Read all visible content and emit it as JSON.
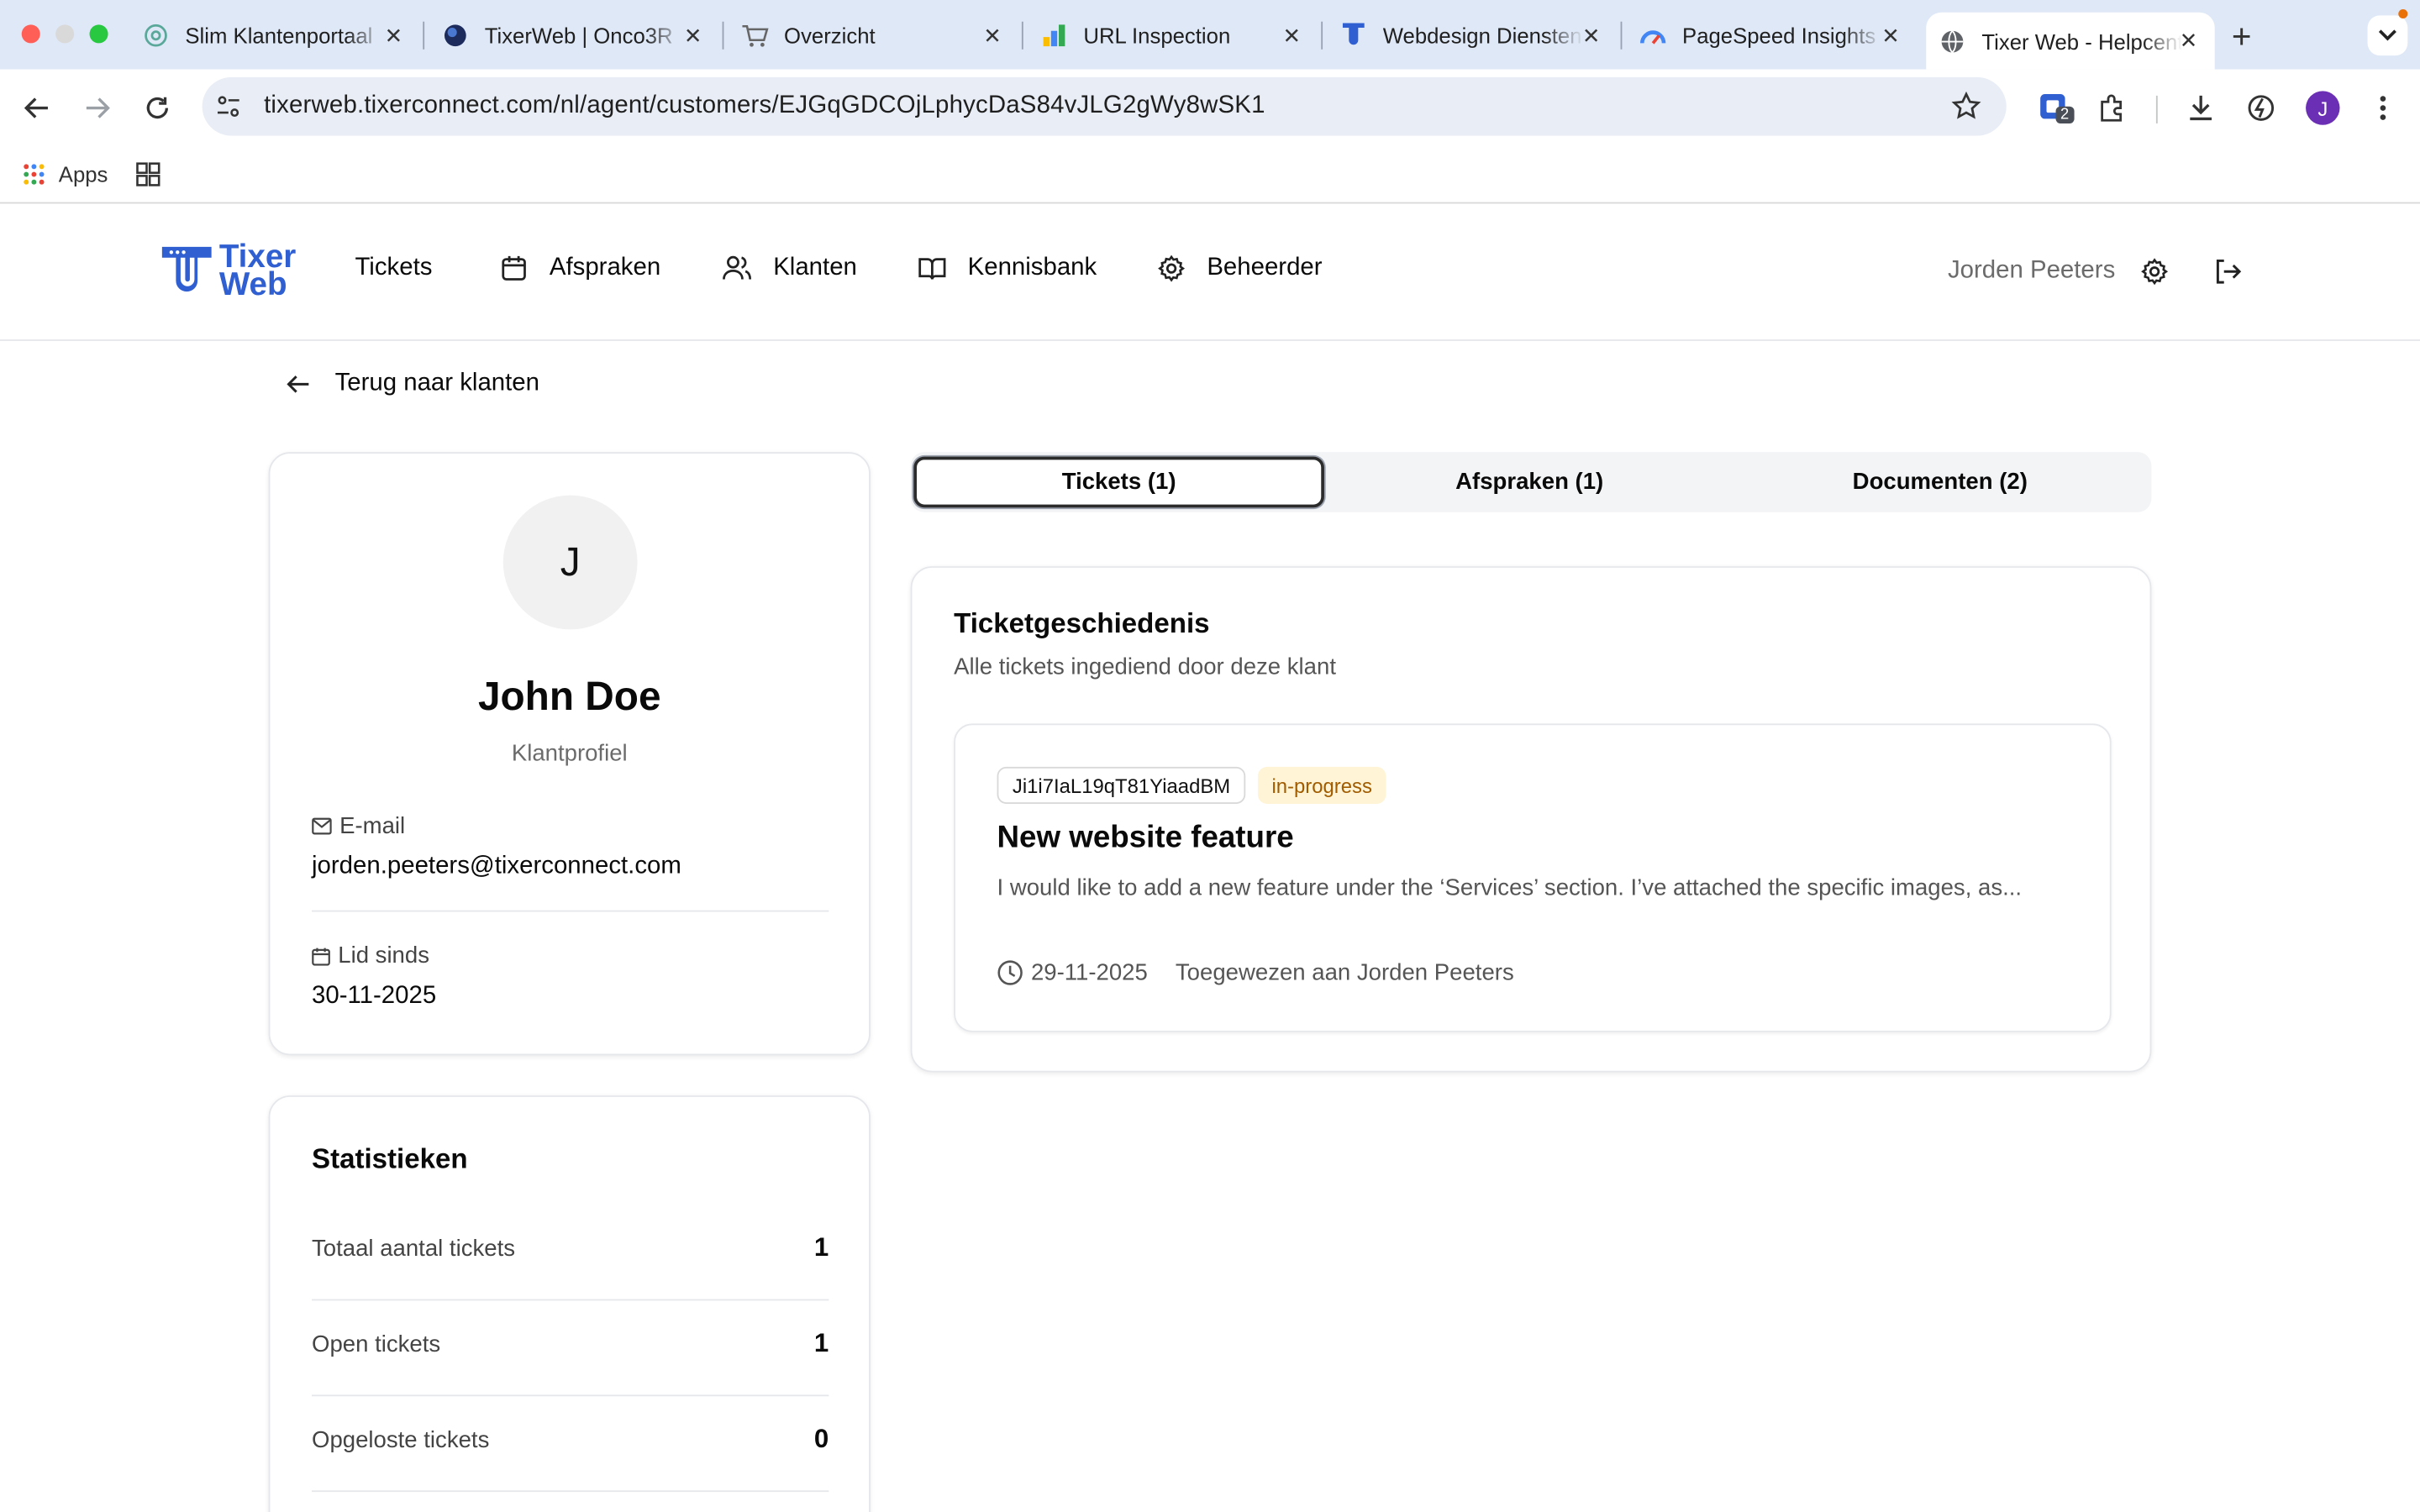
{
  "browser": {
    "tabs": [
      {
        "label": "Slim Klantenportaal",
        "icon": "openai-icon"
      },
      {
        "label": "TixerWeb | Onco3R",
        "icon": "planet-icon"
      },
      {
        "label": "Overzicht",
        "icon": "cart-icon"
      },
      {
        "label": "URL Inspection",
        "icon": "search-console-icon"
      },
      {
        "label": "Webdesign Diensten",
        "icon": "tixer-icon"
      },
      {
        "label": "PageSpeed Insights",
        "icon": "pagespeed-icon"
      },
      {
        "label": "Tixer Web - Helpcenter",
        "icon": "globe-icon"
      }
    ],
    "url": "tixerweb.tixerconnect.com/nl/agent/customers/EJGqGDCOjLphycDaS84vJLG2gWy8wSK1",
    "extension_badge": "2",
    "profile_initial": "J",
    "bookmarks": {
      "apps_label": "Apps"
    }
  },
  "app": {
    "logo": {
      "line1": "Tixer",
      "line2": "Web"
    },
    "nav": [
      {
        "label": "Tickets",
        "icon": "none"
      },
      {
        "label": "Afspraken",
        "icon": "calendar-icon"
      },
      {
        "label": "Klanten",
        "icon": "users-icon"
      },
      {
        "label": "Kennisbank",
        "icon": "book-icon"
      },
      {
        "label": "Beheerder",
        "icon": "gear-icon"
      }
    ],
    "user_name": "Jorden Peeters",
    "back_label": "Terug naar klanten"
  },
  "customer": {
    "avatar_initial": "J",
    "name": "John Doe",
    "subtitle": "Klantprofiel",
    "email_label": "E-mail",
    "email": "jorden.peeters@tixerconnect.com",
    "member_since_label": "Lid sinds",
    "member_since": "30-11-2025"
  },
  "stats": {
    "title": "Statistieken",
    "rows": [
      {
        "label": "Totaal aantal tickets",
        "value": "1"
      },
      {
        "label": "Open tickets",
        "value": "1"
      },
      {
        "label": "Opgeloste tickets",
        "value": "0"
      }
    ]
  },
  "tabs": [
    {
      "label": "Tickets (1)",
      "active": true
    },
    {
      "label": "Afspraken (1)",
      "active": false
    },
    {
      "label": "Documenten (2)",
      "active": false
    }
  ],
  "history": {
    "title": "Ticketgeschiedenis",
    "subtitle": "Alle tickets ingediend door deze klant",
    "ticket": {
      "id": "Ji1i7IaL19qT81YiaadBM",
      "status": "in-progress",
      "title": "New website feature",
      "description": "I would like to add a new feature under the ‘Services’ section. I’ve attached the specific images, as...",
      "date": "29-11-2025",
      "assigned": "Toegewezen aan Jorden Peeters"
    }
  },
  "colors": {
    "brand": "#2f5fd0",
    "status_bg": "#fff4d6",
    "status_text": "#a15c00",
    "tabbar": "#dfe8f7"
  }
}
